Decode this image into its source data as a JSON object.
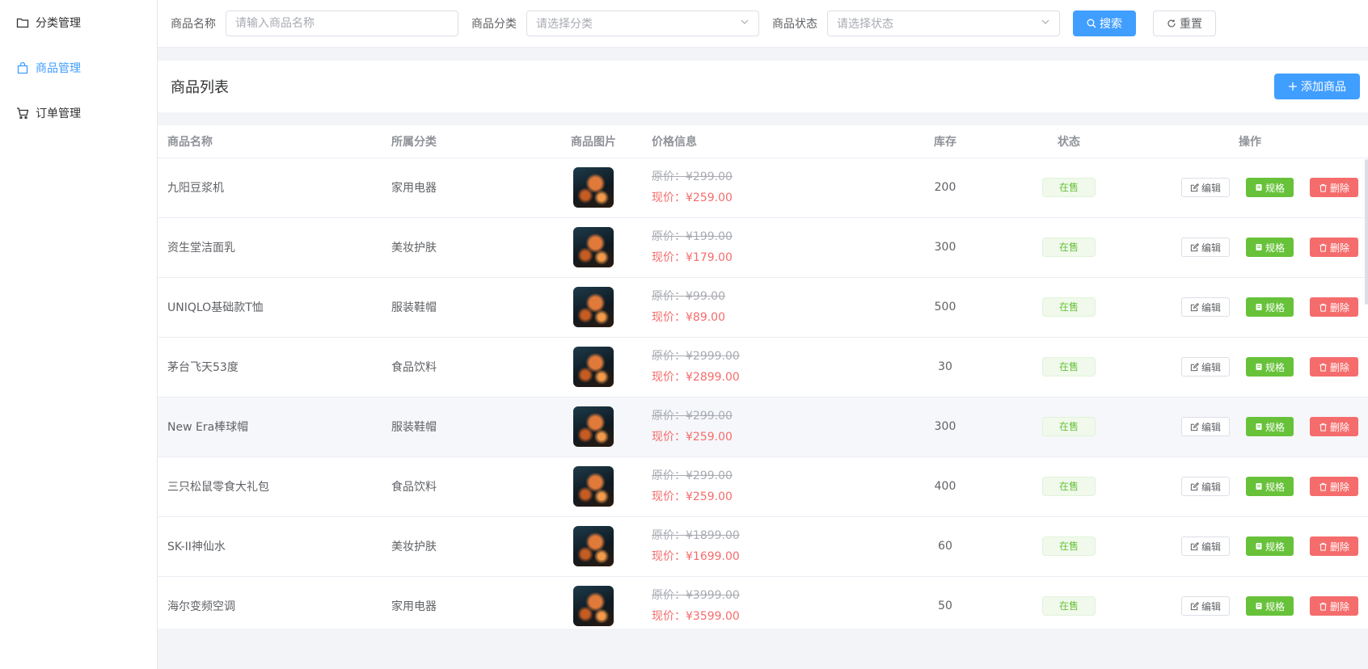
{
  "sidebar": {
    "items": [
      {
        "label": "分类管理",
        "icon": "folder-icon"
      },
      {
        "label": "商品管理",
        "icon": "shopping-bag-icon",
        "active": true
      },
      {
        "label": "订单管理",
        "icon": "cart-icon"
      }
    ]
  },
  "search": {
    "name_label": "商品名称",
    "name_placeholder": "请输入商品名称",
    "category_label": "商品分类",
    "category_placeholder": "请选择分类",
    "status_label": "商品状态",
    "status_placeholder": "请选择状态",
    "search_button": "搜索",
    "reset_button": "重置"
  },
  "list": {
    "title": "商品列表",
    "add_button": "添加商品"
  },
  "table": {
    "headers": [
      "商品名称",
      "所属分类",
      "商品图片",
      "价格信息",
      "库存",
      "状态",
      "操作"
    ],
    "old_price_prefix": "原价：",
    "new_price_prefix": "现价：",
    "rows": [
      {
        "name": "九阳豆浆机",
        "category": "家用电器",
        "old_price": "原价：¥299.00",
        "new_price": "现价：¥259.00",
        "stock": "200",
        "status": "在售"
      },
      {
        "name": "资生堂洁面乳",
        "category": "美妆护肤",
        "old_price": "原价：¥199.00",
        "new_price": "现价：¥179.00",
        "stock": "300",
        "status": "在售"
      },
      {
        "name": "UNIQLO基础款T恤",
        "category": "服装鞋帽",
        "old_price": "原价：¥99.00",
        "new_price": "现价：¥89.00",
        "stock": "500",
        "status": "在售"
      },
      {
        "name": "茅台飞天53度",
        "category": "食品饮料",
        "old_price": "原价：¥2999.00",
        "new_price": "现价：¥2899.00",
        "stock": "30",
        "status": "在售"
      },
      {
        "name": "New Era棒球帽",
        "category": "服装鞋帽",
        "old_price": "原价：¥299.00",
        "new_price": "现价：¥259.00",
        "stock": "300",
        "status": "在售"
      },
      {
        "name": "三只松鼠零食大礼包",
        "category": "食品饮料",
        "old_price": "原价：¥299.00",
        "new_price": "现价：¥259.00",
        "stock": "400",
        "status": "在售"
      },
      {
        "name": "SK-II神仙水",
        "category": "美妆护肤",
        "old_price": "原价：¥1899.00",
        "new_price": "现价：¥1699.00",
        "stock": "60",
        "status": "在售"
      },
      {
        "name": "海尔变频空调",
        "category": "家用电器",
        "old_price": "原价：¥3999.00",
        "new_price": "现价：¥3599.00",
        "stock": "50",
        "status": "在售"
      }
    ],
    "edit_label": "编辑",
    "spec_label": "规格",
    "delete_label": "删除"
  },
  "colors": {
    "primary": "#409eff",
    "success": "#67c23a",
    "danger": "#f56c6c",
    "price_new": "#f56c6c"
  }
}
